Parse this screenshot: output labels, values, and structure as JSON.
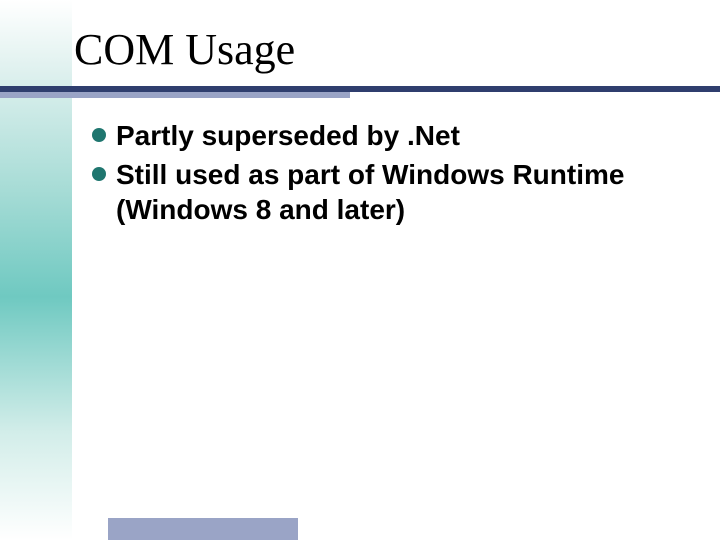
{
  "title": "COM Usage",
  "bullets": [
    "Partly superseded by .Net",
    "Still used as part of Windows Runtime (Windows 8 and later)"
  ],
  "colors": {
    "bullet": "#1f766f",
    "underline_dark": "#2f3e6e",
    "underline_light": "#9aa4c6"
  }
}
